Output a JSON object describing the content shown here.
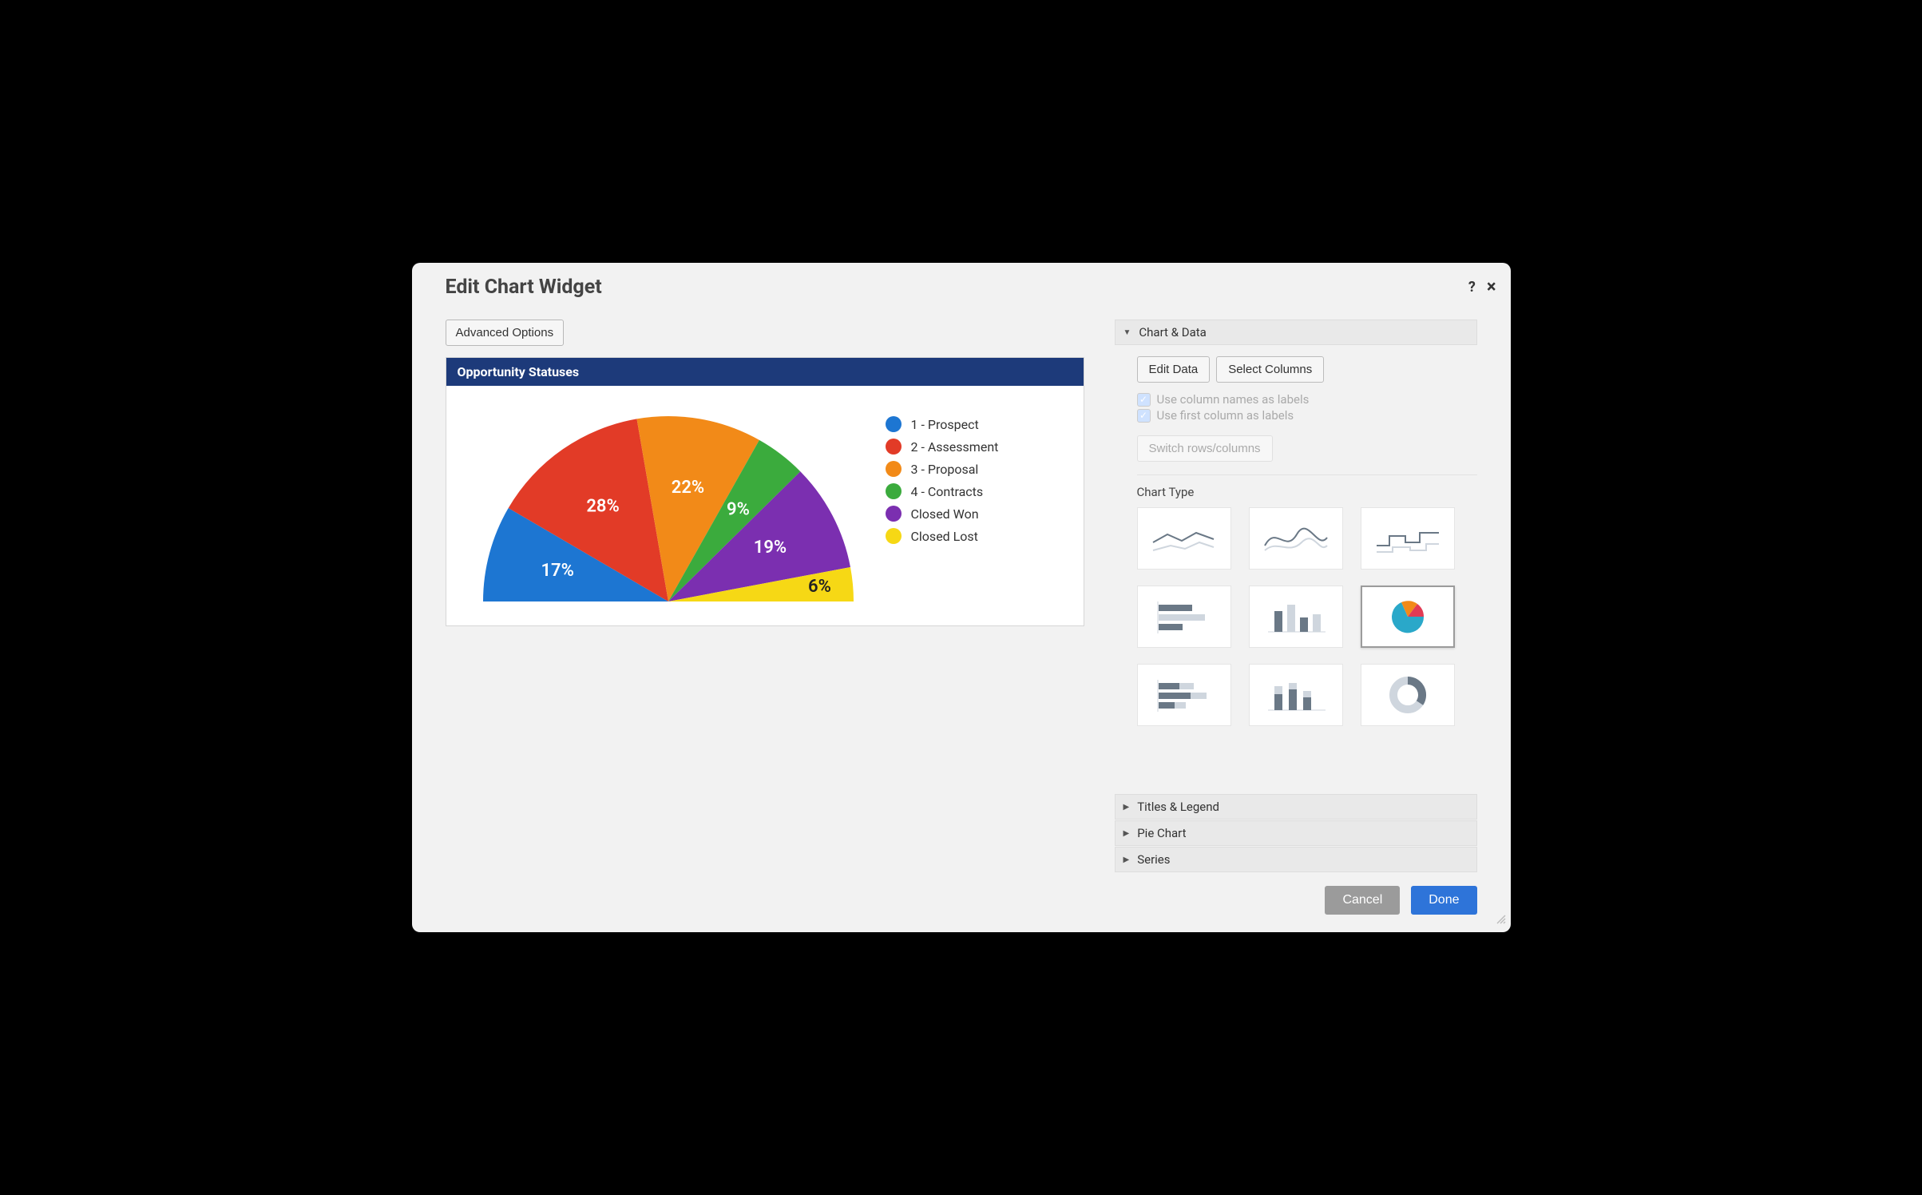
{
  "dialog": {
    "title": "Edit Chart Widget",
    "help_tooltip": "?",
    "close_tooltip": "×"
  },
  "left": {
    "advanced_options": "Advanced Options",
    "chart_title": "Opportunity Statuses"
  },
  "chart_data": {
    "type": "pie",
    "variant": "half",
    "title": "Opportunity Statuses",
    "series": [
      {
        "name": "1 - Prospect",
        "value": 17,
        "label": "17%",
        "color": "#1d76d2"
      },
      {
        "name": "2 - Assessment",
        "value": 28,
        "label": "28%",
        "color": "#e23b27"
      },
      {
        "name": "3 - Proposal",
        "value": 22,
        "label": "22%",
        "color": "#f28a18"
      },
      {
        "name": "4 - Contracts",
        "value": 9,
        "label": "9%",
        "color": "#3bab3d"
      },
      {
        "name": "Closed Won",
        "value": 19,
        "label": "19%",
        "color": "#7b2fb0"
      },
      {
        "name": "Closed Lost",
        "value": 6,
        "label": "6%",
        "color": "#f6d815"
      }
    ]
  },
  "right": {
    "sections": {
      "chart_data": "Chart & Data",
      "titles_legend": "Titles & Legend",
      "pie_chart": "Pie Chart",
      "series": "Series"
    },
    "buttons": {
      "edit_data": "Edit Data",
      "select_columns": "Select Columns",
      "switch_rows": "Switch rows/columns"
    },
    "checkboxes": {
      "use_col_names": "Use column names as labels",
      "use_first_col": "Use first column as labels"
    },
    "chart_type_label": "Chart Type",
    "chart_types": [
      "line",
      "spline",
      "step",
      "bar-horizontal",
      "bar-vertical",
      "pie",
      "bar-horizontal-stacked",
      "bar-vertical-stacked",
      "donut"
    ],
    "selected_chart_type": "pie"
  },
  "footer": {
    "cancel": "Cancel",
    "done": "Done"
  }
}
